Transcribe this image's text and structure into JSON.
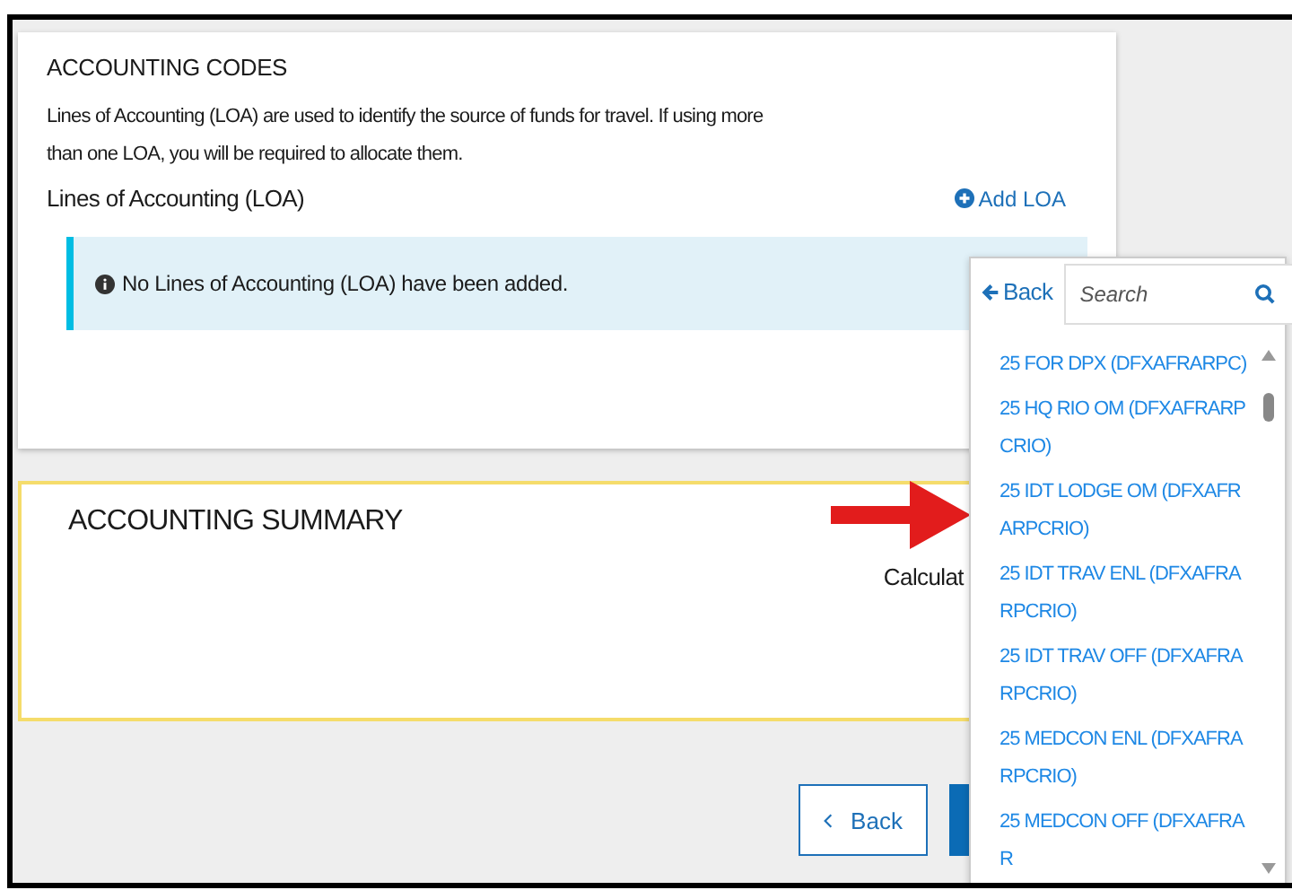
{
  "accounting_codes": {
    "title": "ACCOUNTING CODES",
    "description": "Lines of Accounting (LOA) are used to identify the source of funds for travel. If using more than one LOA, you will be required to allocate them.",
    "loa_heading": "Lines of Accounting (LOA)",
    "add_link": "Add LOA",
    "alert": "No Lines of Accounting (LOA) have been added."
  },
  "accounting_summary": {
    "title": "ACCOUNTING SUMMARY",
    "calc_label": "Calculat"
  },
  "footer": {
    "back_button": "Back"
  },
  "dropdown": {
    "back_link": "Back",
    "search": {
      "placeholder": "Search"
    },
    "items": [
      {
        "label": "25 FOR DPX (DFXAFRARPC)"
      },
      {
        "label": "25 HQ RIO OM (DFXAFRARPCRIO)"
      },
      {
        "label": "25 IDT LODGE OM (DFXAFRARPCRIO)"
      },
      {
        "label": "25 IDT TRAV ENL (DFXAFRARPCRIO)"
      },
      {
        "label": "25 IDT TRAV OFF (DFXAFRARPCRIO)"
      },
      {
        "label": "25 MEDCON ENL (DFXAFRARPCRIO)"
      },
      {
        "label": "25 MEDCON OFF (DFXAFRAR"
      }
    ]
  }
}
